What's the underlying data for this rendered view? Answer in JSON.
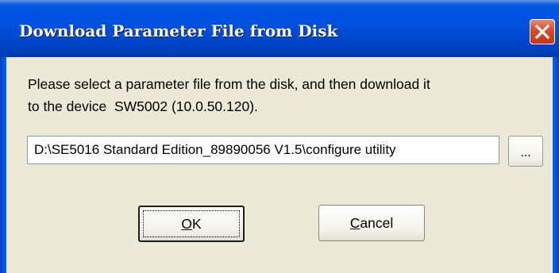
{
  "dialog": {
    "title": "Download Parameter File from Disk",
    "message_line1": "Please select a parameter file from the disk, and then download it",
    "message_line2": "to the device  SW5002 (10.0.50.120).",
    "path_value": "D:\\SE5016 Standard Edition_89890056 V1.5\\configure utility",
    "browse_label": "...",
    "ok_mnemonic": "O",
    "ok_rest": "K",
    "cancel_mnemonic": "C",
    "cancel_rest": "ancel"
  },
  "icons": {
    "close": "close-icon"
  },
  "colors": {
    "titlebar": "#0054e3",
    "close_button": "#d44a2a",
    "dialog_face": "#ece9d8"
  }
}
